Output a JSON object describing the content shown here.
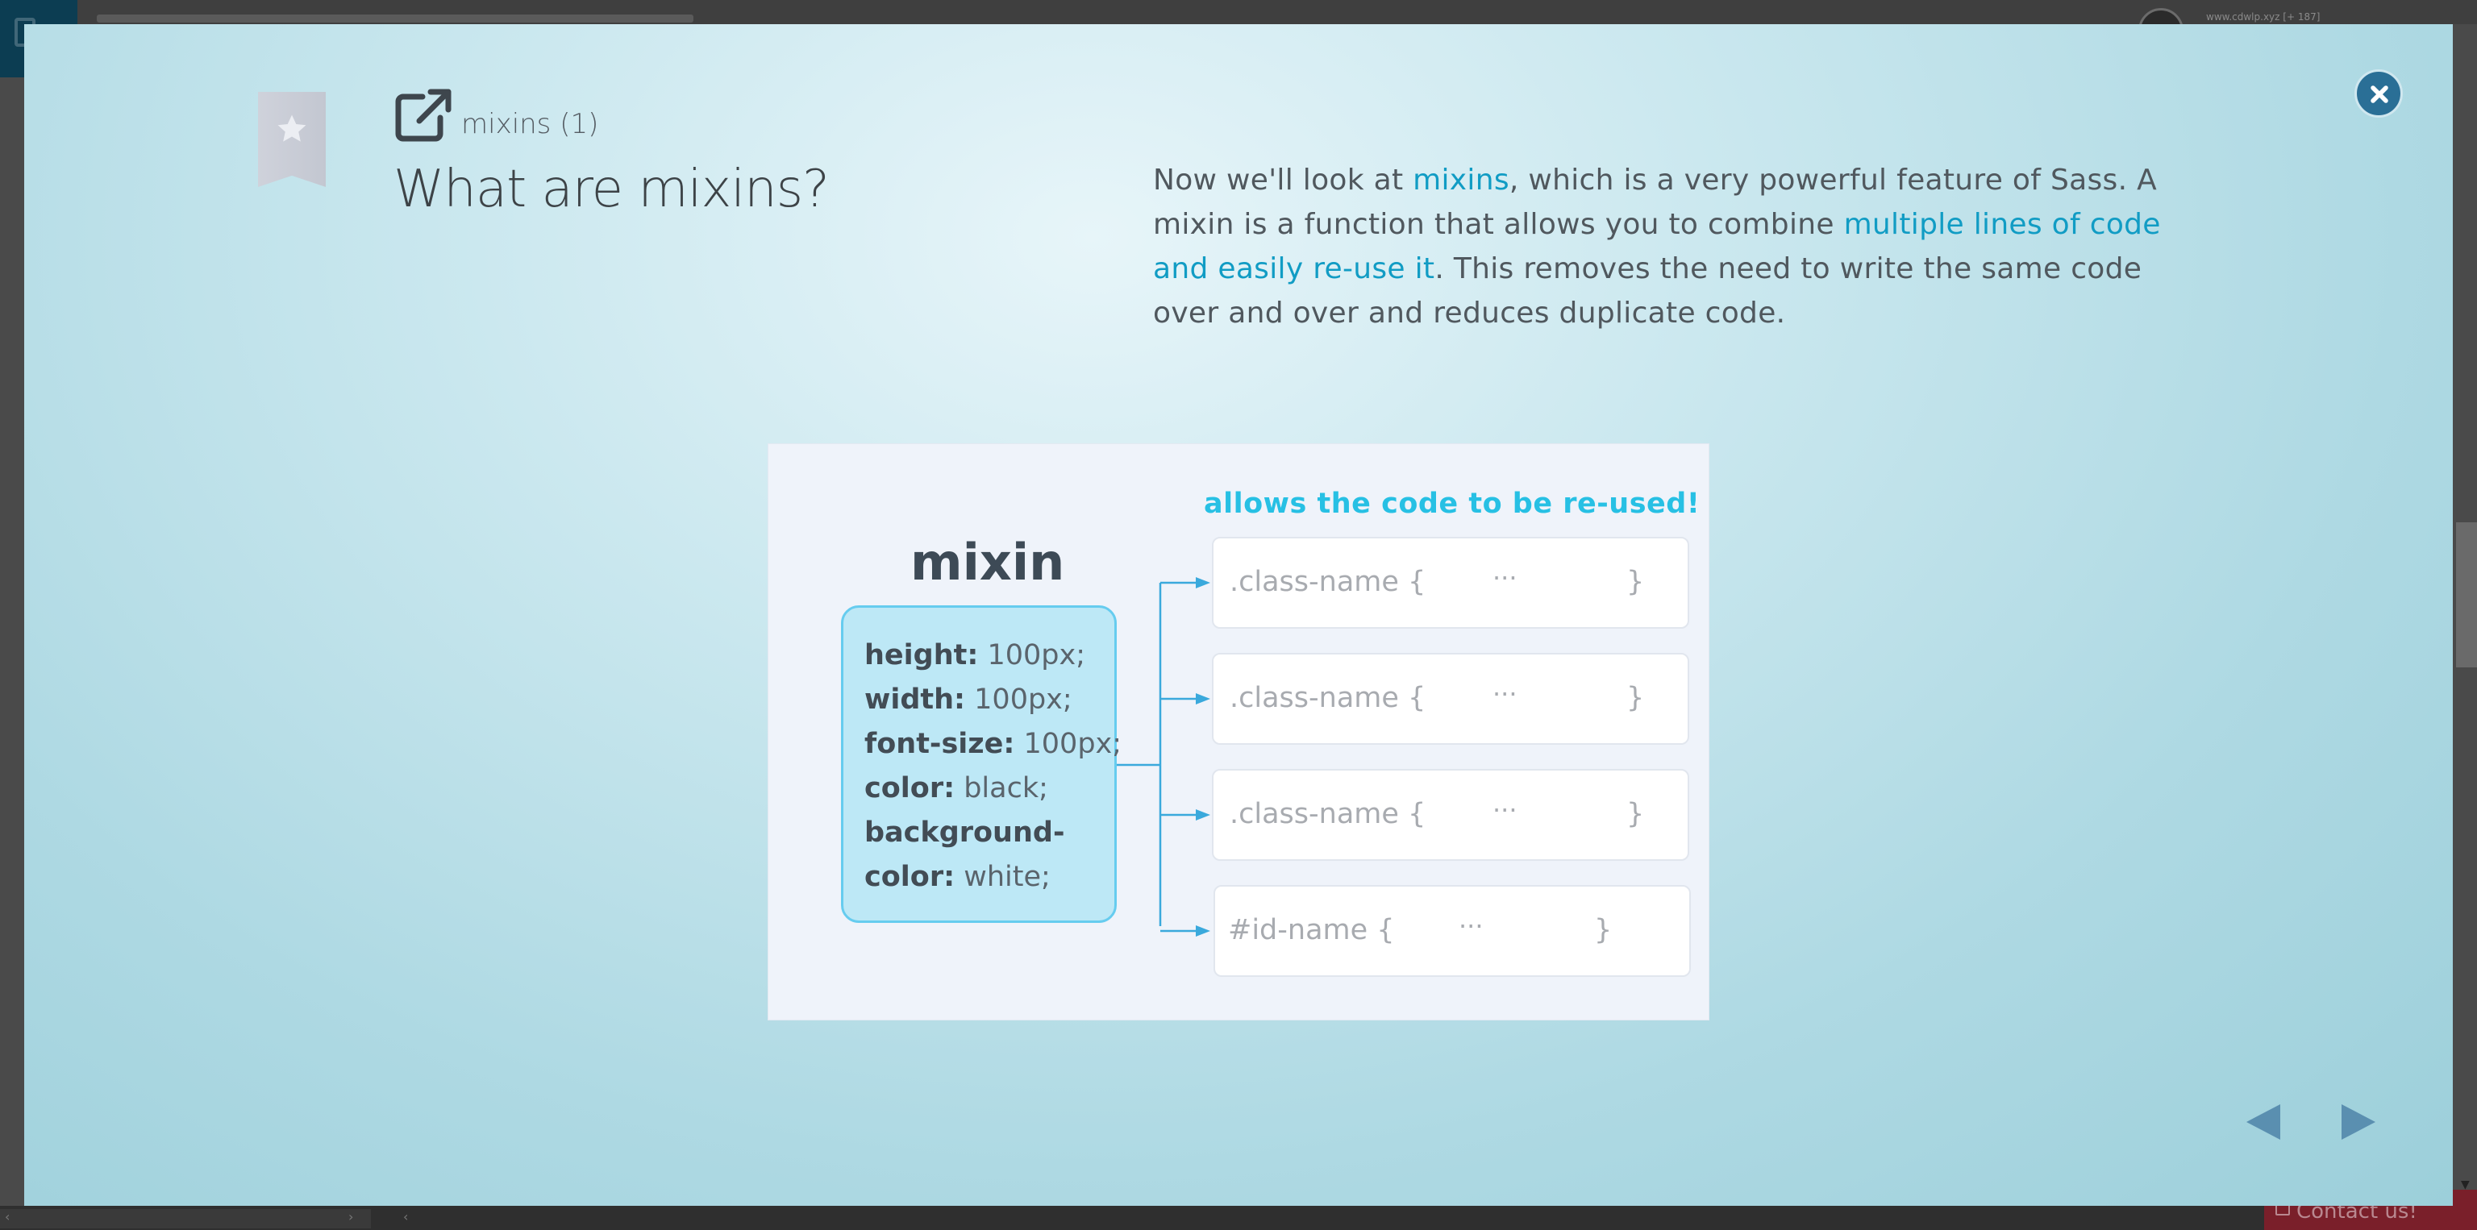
{
  "background": {
    "user_text": "www.cdwlp.xyz [+ 187]",
    "contact_label": "Contact us!"
  },
  "lesson": {
    "breadcrumb": "mixins (1)",
    "title": "What are mixins?",
    "intro": {
      "part1": "Now we'll look at ",
      "link1": "mixins",
      "part2": ", which is a very powerful feature of Sass. A mixin is a function that allows you to combine ",
      "link2": "multiple lines of code and easily re-use it",
      "part3": ". This removes the need to write the same code over and over and reduces duplicate code."
    }
  },
  "diagram": {
    "caption": "allows the code to be re-used!",
    "heading": "mixin",
    "properties": [
      {
        "name": "height:",
        "value": " 100px;"
      },
      {
        "name": "width:",
        "value": " 100px;"
      },
      {
        "name": "font-size:",
        "value": " 100px;"
      },
      {
        "name": "color:",
        "value": " black;"
      },
      {
        "name": "background-",
        "value": ""
      },
      {
        "name": "color:",
        "value": " white;"
      }
    ],
    "targets": [
      {
        "selector": ".class-name {",
        "dots": "···",
        "close": "}"
      },
      {
        "selector": ".class-name {",
        "dots": "···",
        "close": "}"
      },
      {
        "selector": ".class-name {",
        "dots": "···",
        "close": "}"
      },
      {
        "selector": "#id-name {",
        "dots": "···",
        "close": "}"
      }
    ]
  },
  "colors": {
    "accent_link": "#119cc4",
    "caption": "#27c0e4",
    "mixin_box_fill": "#bde8f6",
    "mixin_box_border": "#66ccef",
    "close_button": "#2a6f96",
    "nav_arrow": "#5a8fb0"
  },
  "icons": {
    "bookmark": "star-bookmark-icon",
    "open_external": "external-link-icon",
    "close": "close-x-icon",
    "prev": "triangle-left-icon",
    "next": "triangle-right-icon"
  }
}
